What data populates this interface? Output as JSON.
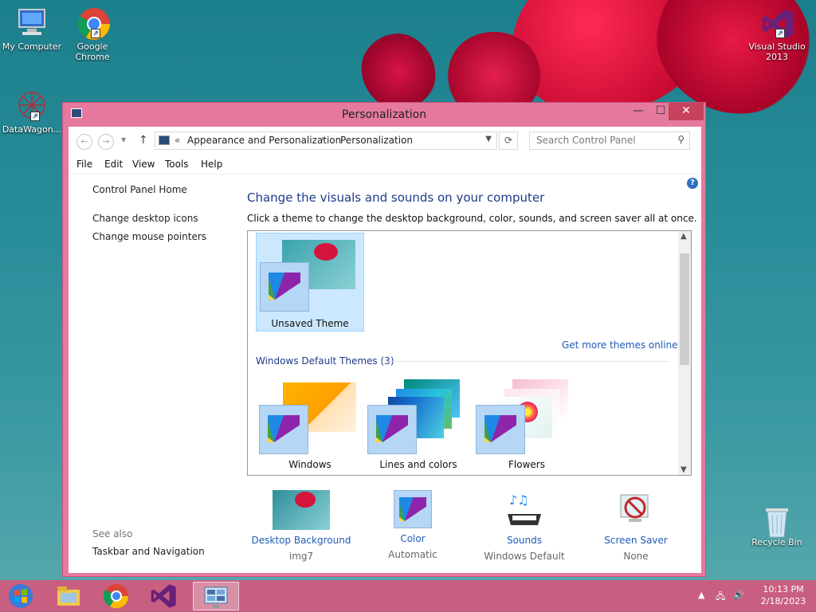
{
  "desktop": {
    "icons": [
      {
        "label": "My Computer"
      },
      {
        "label": "Google\nChrome"
      },
      {
        "label": "DataWagon..."
      },
      {
        "label": "Visual Studio\n2013"
      },
      {
        "label": "Recycle Bin"
      }
    ]
  },
  "window": {
    "title": "Personalization",
    "controls": {
      "minimize": "—",
      "maximize": "☐",
      "close": "✕"
    },
    "address": {
      "chevron": "«",
      "crumb1": "Appearance and Personalization",
      "separator": "›",
      "crumb2": "Personalization"
    },
    "search_placeholder": "Search Control Panel",
    "menu": [
      "File",
      "Edit",
      "View",
      "Tools",
      "Help"
    ],
    "left_nav": {
      "links": [
        "Control Panel Home",
        "Change desktop icons",
        "Change mouse pointers"
      ],
      "see_also_heading": "See also",
      "see_also": [
        "Taskbar and Navigation"
      ]
    },
    "heading": "Change the visuals and sounds on your computer",
    "subheading": "Click a theme to change the desktop background, color, sounds, and screen saver all at once.",
    "my_themes": [
      {
        "name": "Unsaved Theme",
        "selected": true
      }
    ],
    "more_themes_link": "Get more themes online",
    "default_group": "Windows Default Themes (3)",
    "default_themes": [
      {
        "name": "Windows"
      },
      {
        "name": "Lines and colors"
      },
      {
        "name": "Flowers"
      }
    ],
    "bottom": [
      {
        "label": "Desktop Background",
        "value": "img7"
      },
      {
        "label": "Color",
        "value": "Automatic"
      },
      {
        "label": "Sounds",
        "value": "Windows Default"
      },
      {
        "label": "Screen Saver",
        "value": "None"
      }
    ]
  },
  "taskbar": {
    "clock_time": "10:13 PM",
    "clock_date": "2/18/2023",
    "accent": "#c95f80"
  }
}
